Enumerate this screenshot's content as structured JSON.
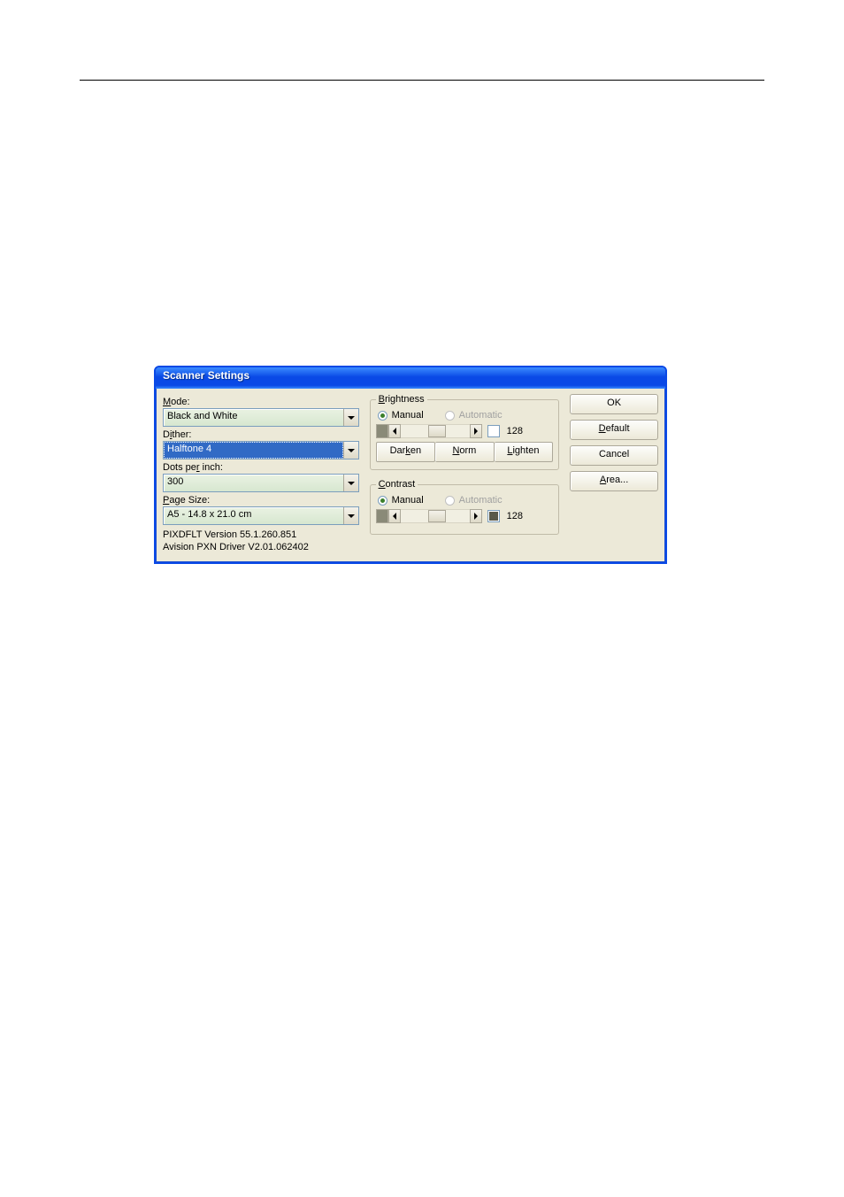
{
  "dialog": {
    "title": "Scanner Settings"
  },
  "left": {
    "mode_label": "Mode:",
    "mode_accel": "M",
    "mode_value": "Black and White",
    "dither_label": "Dither:",
    "dither_accel": "i",
    "dither_value": "Halftone 4",
    "dpi_label": "Dots per inch:",
    "dpi_accel": "r",
    "dpi_value": "300",
    "pagesize_label": "Page Size:",
    "pagesize_accel": "P",
    "pagesize_value": "A5 - 14.8 x 21.0 cm",
    "version1": "PIXDFLT Version 55.1.260.851",
    "version2": "Avision PXN Driver V2.01.062402"
  },
  "brightness": {
    "legend": "Brightness",
    "legend_accel": "B",
    "manual_label": "Manual",
    "automatic_label": "Automatic",
    "value": "128",
    "darken": "Darken",
    "darken_accel": "k",
    "norm": "Norm",
    "norm_accel": "N",
    "lighten": "Lighten",
    "lighten_accel": "L"
  },
  "contrast": {
    "legend": "Contrast",
    "legend_accel": "C",
    "manual_label": "Manual",
    "automatic_label": "Automatic",
    "value": "128"
  },
  "buttons": {
    "ok": "OK",
    "default": "Default",
    "default_accel": "D",
    "cancel": "Cancel",
    "area": "Area...",
    "area_accel": "A"
  }
}
